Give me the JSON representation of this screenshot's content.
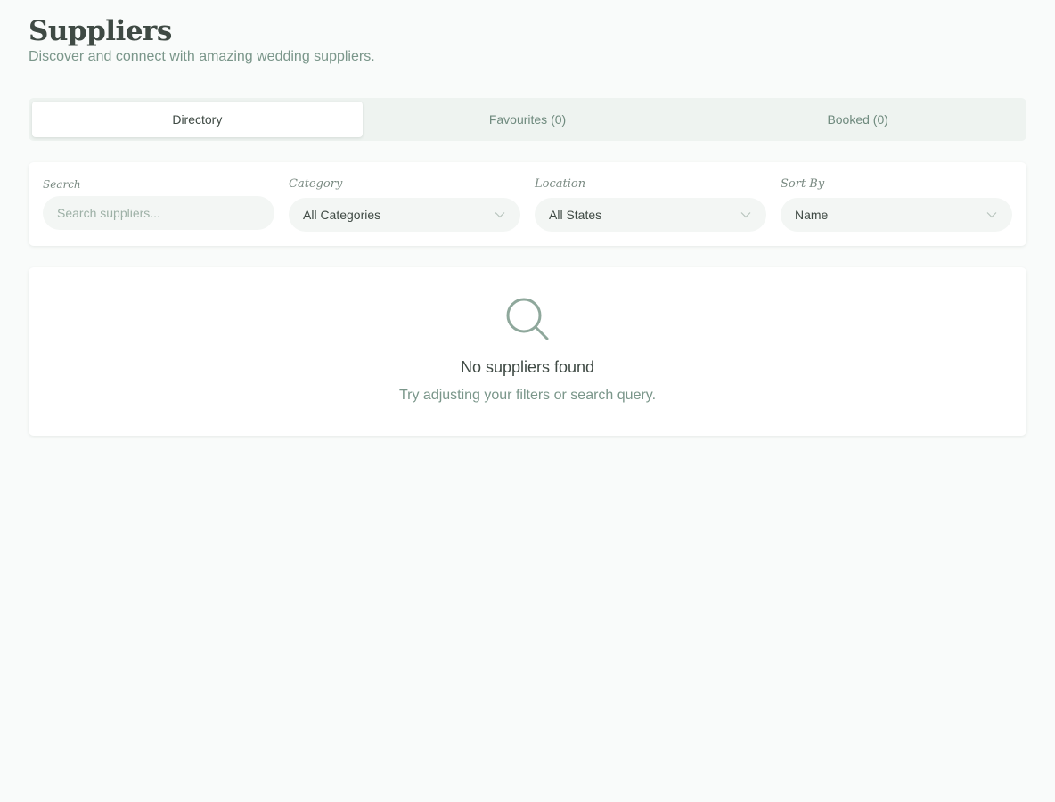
{
  "header": {
    "title": "Suppliers",
    "subtitle": "Discover and connect with amazing wedding suppliers."
  },
  "tabs": [
    {
      "label": "Directory",
      "active": true
    },
    {
      "label": "Favourites (0)",
      "active": false
    },
    {
      "label": "Booked (0)",
      "active": false
    }
  ],
  "filters": {
    "search": {
      "label": "Search",
      "placeholder": "Search suppliers...",
      "value": ""
    },
    "category": {
      "label": "Category",
      "value": "All Categories"
    },
    "location": {
      "label": "Location",
      "value": "All States"
    },
    "sort": {
      "label": "Sort By",
      "value": "Name"
    }
  },
  "empty_state": {
    "icon": "search-icon",
    "title": "No suppliers found",
    "message": "Try adjusting your filters or search query."
  },
  "colors": {
    "background": "#f9fbfa",
    "accent": "#7a968a",
    "text": "#3f4a44"
  }
}
